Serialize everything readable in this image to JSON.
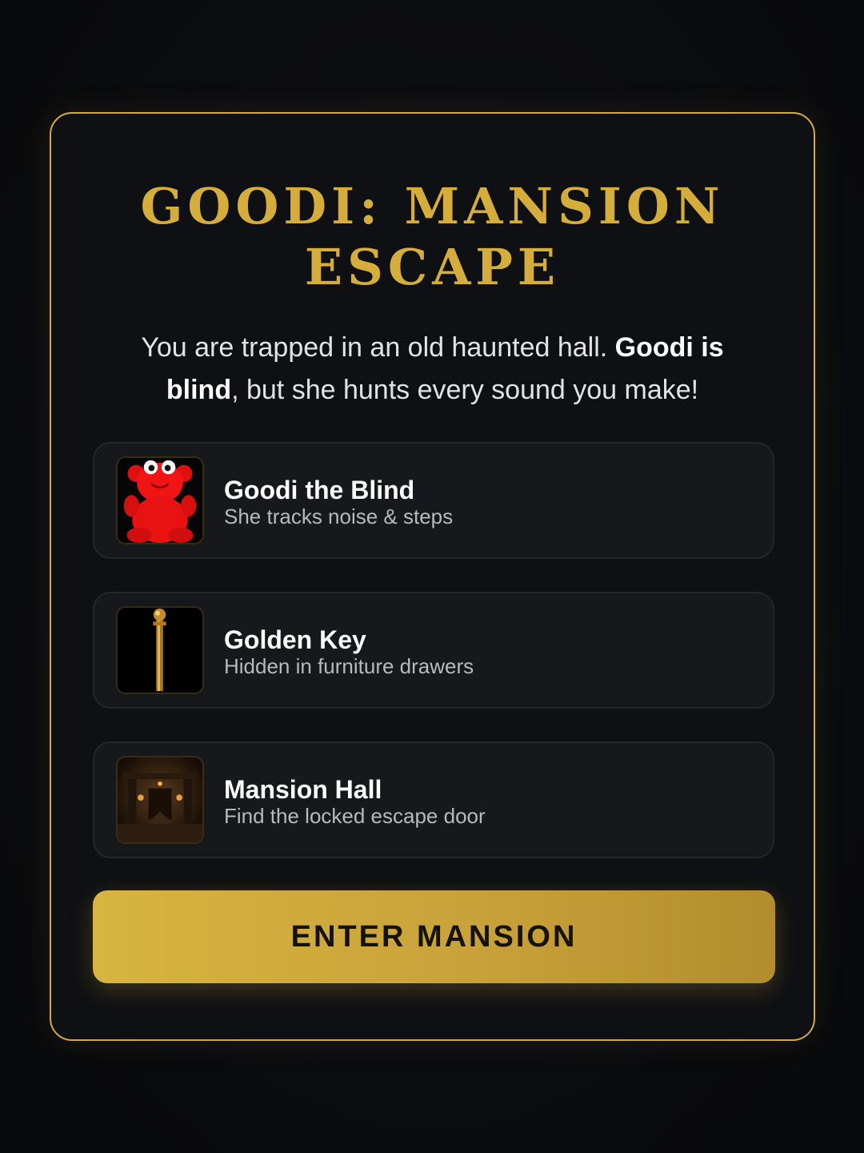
{
  "title": "GOODI: MANSION ESCAPE",
  "intro": {
    "part1": "You are trapped in an old haunted hall. ",
    "bold1": "Goodi is blind",
    "part2": ", but she hunts every sound you make!"
  },
  "items": [
    {
      "title": "Goodi the Blind",
      "subtitle": "She tracks noise & steps",
      "icon": "red-gummy-bear-icon"
    },
    {
      "title": "Golden Key",
      "subtitle": "Hidden in furniture drawers",
      "icon": "golden-key-icon"
    },
    {
      "title": "Mansion Hall",
      "subtitle": "Find the locked escape door",
      "icon": "mansion-hall-icon"
    }
  ],
  "enter_button": "ENTER MANSION",
  "colors": {
    "accent": "#d4ad3a",
    "background": "#0b0c0f",
    "card": "#0f1013"
  }
}
